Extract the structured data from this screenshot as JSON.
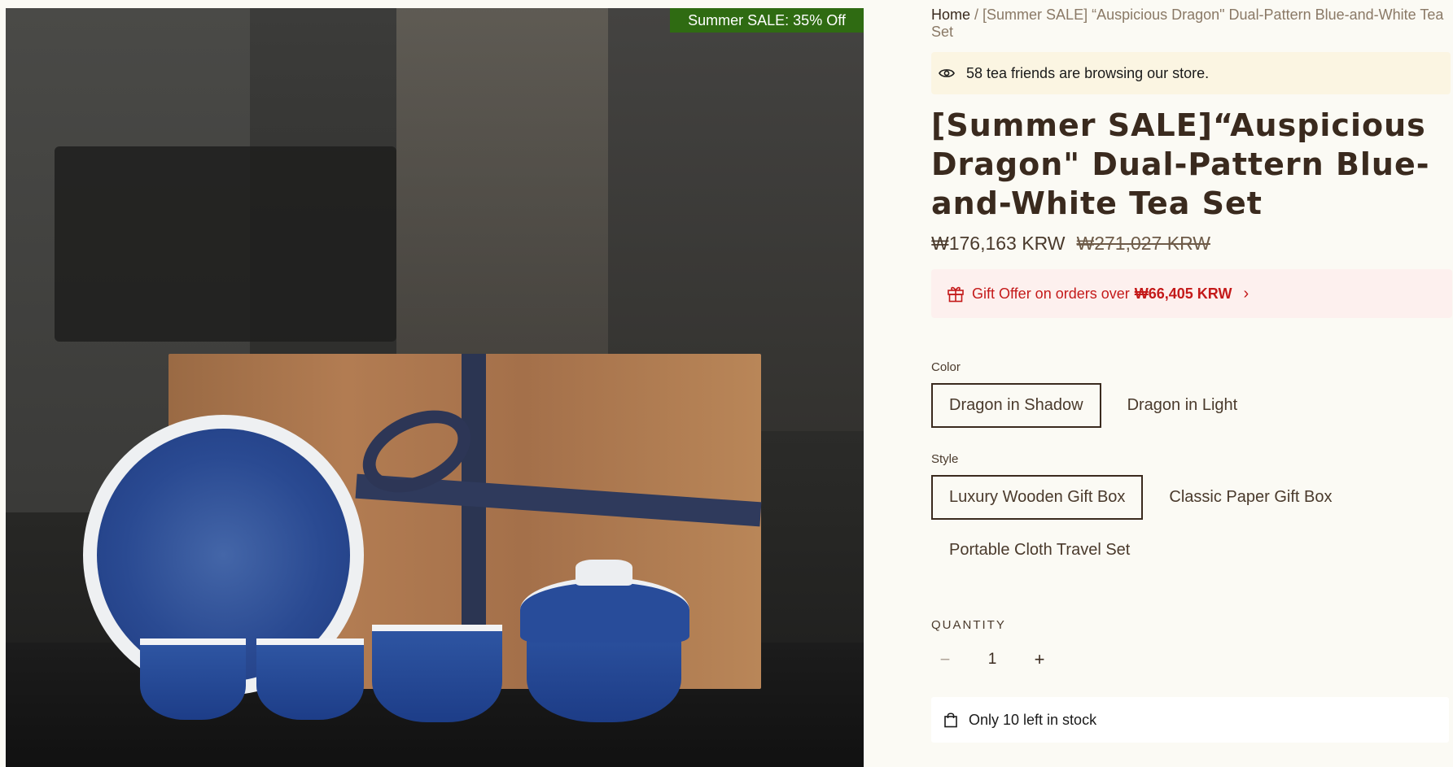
{
  "gallery": {
    "sale_badge": "Summer SALE: 35% Off",
    "image_alt": "Blue-and-white dragon tea set with wooden gift box"
  },
  "breadcrumb": {
    "home": "Home",
    "separator": " / ",
    "current": "[Summer SALE] “Auspicious Dragon\" Dual-Pattern Blue-and-White Tea Set"
  },
  "browsing": {
    "icon": "eye-icon",
    "text": "58 tea friends are browsing our store."
  },
  "product": {
    "title": "[Summer SALE]“Auspicious Dragon\" Dual-Pattern Blue-and-White Tea Set",
    "price": "₩176,163 KRW",
    "compare_price": "₩271,027 KRW"
  },
  "gift_offer": {
    "icon": "gift-icon",
    "text": "Gift Offer on orders over",
    "amount": "₩66,405 KRW",
    "chevron": "›"
  },
  "options": {
    "color": {
      "label": "Color",
      "values": [
        "Dragon in Shadow",
        "Dragon in Light"
      ],
      "selected": "Dragon in Shadow"
    },
    "style": {
      "label": "Style",
      "values": [
        "Luxury Wooden Gift Box",
        "Classic Paper Gift Box",
        "Portable Cloth Travel Set"
      ],
      "selected": "Luxury Wooden Gift Box"
    }
  },
  "quantity": {
    "label": "QUANTITY",
    "minus": "−",
    "value": "1",
    "plus": "+"
  },
  "stock": {
    "icon": "shopping-bag-icon",
    "text": "Only 10 left in stock"
  },
  "colors": {
    "page_bg": "#fbfaf4",
    "sale_badge_bg": "#2f6b12",
    "gift_red": "#c41a1a",
    "browsing_bg": "#fbf5e2",
    "text_brown": "#3a2a1e"
  }
}
